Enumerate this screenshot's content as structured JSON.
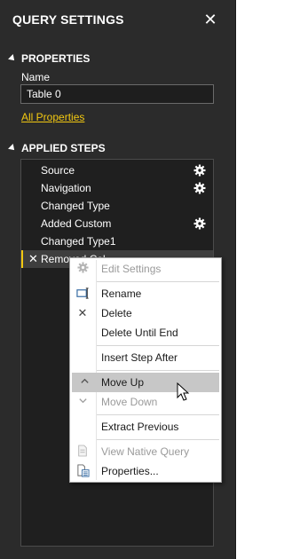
{
  "pane": {
    "title": "QUERY SETTINGS",
    "close_icon": "close-icon"
  },
  "properties": {
    "heading": "PROPERTIES",
    "name_label": "Name",
    "name_value": "Table 0",
    "all_properties_link": "All Properties"
  },
  "applied_steps": {
    "heading": "APPLIED STEPS",
    "items": [
      {
        "label": "Source",
        "has_gear": true
      },
      {
        "label": "Navigation",
        "has_gear": true
      },
      {
        "label": "Changed Type",
        "has_gear": false
      },
      {
        "label": "Added Custom",
        "has_gear": true
      },
      {
        "label": "Changed Type1",
        "has_gear": false
      },
      {
        "label": "Removed Col",
        "has_gear": false,
        "selected": true
      }
    ]
  },
  "context_menu": {
    "items": [
      {
        "label": "Edit Settings",
        "icon": "gear-icon",
        "disabled": true
      },
      {
        "label": "Rename",
        "icon": "rename-icon",
        "disabled": false
      },
      {
        "label": "Delete",
        "icon": "delete-x-icon",
        "disabled": false
      },
      {
        "label": "Delete Until End",
        "icon": "",
        "disabled": false
      },
      {
        "label": "Insert Step After",
        "icon": "",
        "disabled": false
      },
      {
        "label": "Move Up",
        "icon": "chevron-up-icon",
        "disabled": false,
        "highlighted": true
      },
      {
        "label": "Move Down",
        "icon": "chevron-down-icon",
        "disabled": true
      },
      {
        "label": "Extract Previous",
        "icon": "",
        "disabled": false
      },
      {
        "label": "View Native Query",
        "icon": "native-query-icon",
        "disabled": true
      },
      {
        "label": "Properties...",
        "icon": "properties-icon",
        "disabled": false
      }
    ]
  },
  "colors": {
    "pane_bg": "#2b2b2b",
    "accent": "#f2c811",
    "menu_highlight": "#c7c7c7"
  }
}
